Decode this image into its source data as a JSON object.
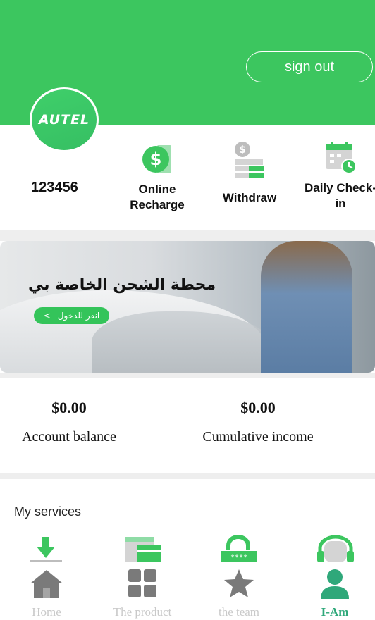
{
  "header": {
    "sign_out": "sign out",
    "logo_text": "AUTEL"
  },
  "user": {
    "id": "123456"
  },
  "quick_actions": [
    {
      "label": "Online Recharge",
      "icon": "dollar-coin-icon"
    },
    {
      "label": "Withdraw",
      "icon": "withdraw-icon"
    },
    {
      "label": "Daily Check-in",
      "icon": "calendar-clock-icon"
    }
  ],
  "banner": {
    "title": "محطة الشحن الخاصة بي",
    "button_label": "انقر للدخول",
    "button_arrow": "<"
  },
  "stats": [
    {
      "value": "$0.00",
      "caption": "Account balance"
    },
    {
      "value": "$0.00",
      "caption": "Cumulative income"
    }
  ],
  "services": {
    "title": "My services",
    "items": [
      "download-icon",
      "card-icon",
      "lock-password-icon",
      "headset-icon"
    ]
  },
  "tabbar": {
    "active": "I-Am",
    "items": [
      {
        "label": "Home",
        "icon": "home-icon"
      },
      {
        "label": "The product",
        "icon": "grid-icon"
      },
      {
        "label": "the team",
        "icon": "star-icon"
      },
      {
        "label": "I-Am",
        "icon": "person-icon"
      }
    ]
  },
  "colors": {
    "brand_green": "#3cc65f",
    "active_tab": "#2fa87a",
    "inactive_tab": "#c9c9c9"
  }
}
